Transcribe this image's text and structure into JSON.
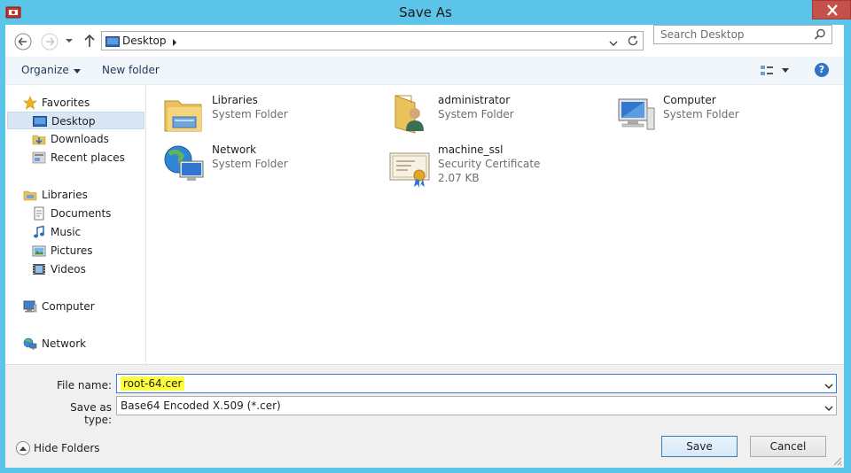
{
  "window": {
    "title": "Save As"
  },
  "navigation": {
    "address_location": "Desktop",
    "search_placeholder": "Search Desktop"
  },
  "toolbar": {
    "organize_label": "Organize",
    "new_folder_label": "New folder",
    "help_label": "?"
  },
  "sidebar": {
    "favorites": {
      "label": "Favorites",
      "items": [
        {
          "label": "Desktop",
          "icon": "desktop-icon",
          "selected": true
        },
        {
          "label": "Downloads",
          "icon": "downloads-icon"
        },
        {
          "label": "Recent places",
          "icon": "recent-places-icon"
        }
      ]
    },
    "libraries": {
      "label": "Libraries",
      "items": [
        {
          "label": "Documents",
          "icon": "documents-icon"
        },
        {
          "label": "Music",
          "icon": "music-icon"
        },
        {
          "label": "Pictures",
          "icon": "pictures-icon"
        },
        {
          "label": "Videos",
          "icon": "videos-icon"
        }
      ]
    },
    "computer": {
      "label": "Computer",
      "icon": "computer-icon"
    },
    "network": {
      "label": "Network",
      "icon": "network-icon"
    }
  },
  "content": {
    "items": [
      {
        "name": "Libraries",
        "type": "System Folder",
        "size": "",
        "icon": "libraries-folder-icon"
      },
      {
        "name": "administrator",
        "type": "System Folder",
        "size": "",
        "icon": "user-folder-icon"
      },
      {
        "name": "Computer",
        "type": "System Folder",
        "size": "",
        "icon": "computer-icon"
      },
      {
        "name": "Network",
        "type": "System Folder",
        "size": "",
        "icon": "network-globe-icon"
      },
      {
        "name": "machine_ssl",
        "type": "Security Certificate",
        "size": "2.07 KB",
        "icon": "certificate-icon"
      }
    ]
  },
  "save_form": {
    "file_name_label": "File name:",
    "file_name_value": "root-64.cer",
    "save_as_type_label": "Save as type:",
    "save_as_type_value": "Base64 Encoded X.509 (*.cer)"
  },
  "footer": {
    "hide_folders_label": "Hide Folders",
    "save_label": "Save",
    "cancel_label": "Cancel"
  },
  "colors": {
    "title_bar": "#5bc4e8",
    "close_button": "#c7504c",
    "selection": "#d9e6f6",
    "filename_highlight": "#ffff3b"
  }
}
